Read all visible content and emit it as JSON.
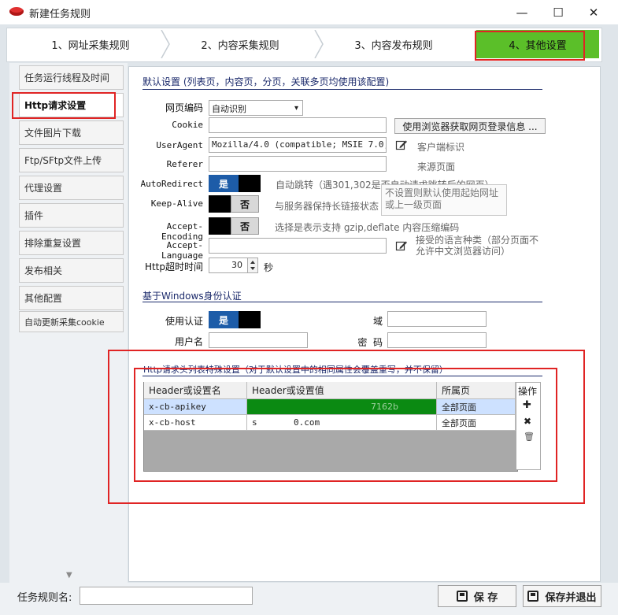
{
  "window": {
    "title": "新建任务规则",
    "minimize": "—",
    "maximize": "☐",
    "close": "✕"
  },
  "steps": [
    "1、网址采集规则",
    "2、内容采集规则",
    "3、内容发布规则",
    "4、其他设置"
  ],
  "nav": [
    "任务运行线程及时间",
    "Http请求设置",
    "文件图片下载",
    "Ftp/SFtp文件上传",
    "代理设置",
    "插件",
    "排除重复设置",
    "发布相关",
    "其他配置",
    "自动更新采集cookie"
  ],
  "nav_scroll": "▼",
  "default_settings": {
    "title": "默认设置 (列表页，内容页，分页，关联多页均使用该配置)",
    "encoding": {
      "label": "网页编码",
      "value": "自动识别",
      "arrow": "▾"
    },
    "cookie": {
      "label": "Cookie",
      "value": "",
      "button": "使用浏览器获取网页登录信息 ..."
    },
    "useragent": {
      "label": "UserAgent",
      "value": "Mozilla/4.0 (compatible; MSIE 7.0; Wi",
      "hint": "客户端标识"
    },
    "referer": {
      "label": "Referer",
      "value": "",
      "hint": "来源页面"
    },
    "autoredirect": {
      "label": "AutoRedirect",
      "toggle": "是",
      "hint": "自动跳转（遇301,302是否自动请求跳转后的网页）"
    },
    "tooltip": "不设置则默认使用起始网址\n或上一级页面",
    "keepalive": {
      "label": "Keep-Alive",
      "toggle": "否",
      "hint": "与服务器保持长链接状态"
    },
    "acceptencoding": {
      "label": "Accept-Encoding",
      "toggle": "否",
      "hint": "选择是表示支持 gzip,deflate 内容压缩编码"
    },
    "acceptlanguage": {
      "label": "Accept-Language",
      "value": "",
      "hint": "接受的语言种类（部分页面不允许中文浏览器访问）"
    },
    "timeout": {
      "label": "Http超时时间",
      "value": "30",
      "unit": "秒"
    }
  },
  "windows_auth": {
    "title": "基于Windows身份认证",
    "use_auth": {
      "label": "使用认证",
      "toggle": "是"
    },
    "domain": {
      "label": "域",
      "value": ""
    },
    "username": {
      "label": "用户名",
      "value": ""
    },
    "password": {
      "label": "密  码",
      "value": ""
    }
  },
  "headers": {
    "title": "Http请求头列表特殊设置（对于默认设置中的相同属性会覆盖重写，并不保留）",
    "columns": [
      "Header或设置名",
      "Header或设置值",
      "所属页"
    ],
    "rows": [
      {
        "name": "x-cb-apikey",
        "value": "7162b",
        "page": "全部页面"
      },
      {
        "name": "x-cb-host",
        "value": "s       0.com",
        "page": "全部页面"
      }
    ],
    "ops_label": "操作",
    "ops_icons": {
      "add": "✚",
      "delete": "✖",
      "trash": "🗑"
    }
  },
  "bottom": {
    "name_label": "任务规则名:",
    "name_value": "",
    "save": "保 存",
    "save_exit": "保存并退出"
  },
  "colors": {
    "accent": "#5bbf29",
    "highlight": "#e02424",
    "toggle_on": "#1d5ca8",
    "section_title": "#1b2a6b"
  }
}
